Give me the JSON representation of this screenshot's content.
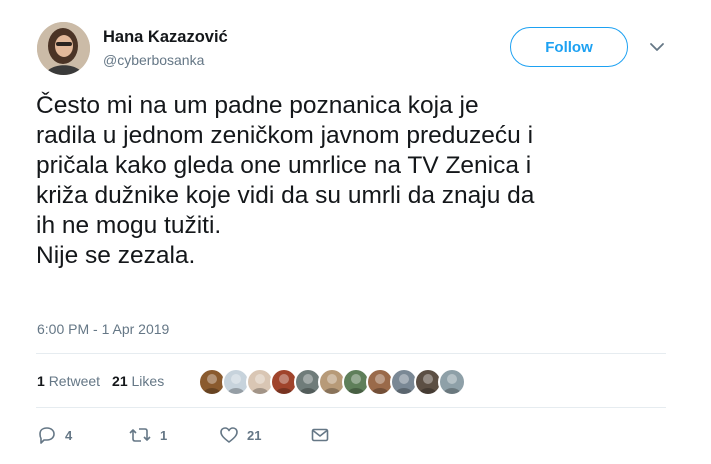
{
  "user": {
    "name": "Hana Kazazović",
    "handle": "@cyberbosanka"
  },
  "follow_label": "Follow",
  "tweet": {
    "text": "Često mi na um padne poznanica koja je\nradila u jednom zeničkom javnom preduzeću i\npričala kako gleda one umrlice na TV Zenica i\nkriža dužnike koje vidi da su umrli da znaju da\nih ne mogu tužiti.\nNije se zezala.",
    "timestamp": "6:00 PM - 1 Apr 2019"
  },
  "stats": {
    "retweets_count": "1",
    "retweets_label": "Retweet",
    "likes_count": "21",
    "likes_label": "Likes"
  },
  "liker_avatars": [
    {
      "color": "#8a5a2e"
    },
    {
      "color": "#c7d3dc"
    },
    {
      "color": "#d9c6b4"
    },
    {
      "color": "#a0442c"
    },
    {
      "color": "#6f7c7a"
    },
    {
      "color": "#b79a78"
    },
    {
      "color": "#5f7f5a"
    },
    {
      "color": "#9a6a4a"
    },
    {
      "color": "#7a8895"
    },
    {
      "color": "#5c4f44"
    },
    {
      "color": "#8ea0a8"
    }
  ],
  "actions": {
    "reply_count": "4",
    "retweet_count": "1",
    "like_count": "21"
  },
  "colors": {
    "accent": "#1da1f2",
    "secondary_text": "#657786",
    "divider": "#e6ecf0"
  }
}
